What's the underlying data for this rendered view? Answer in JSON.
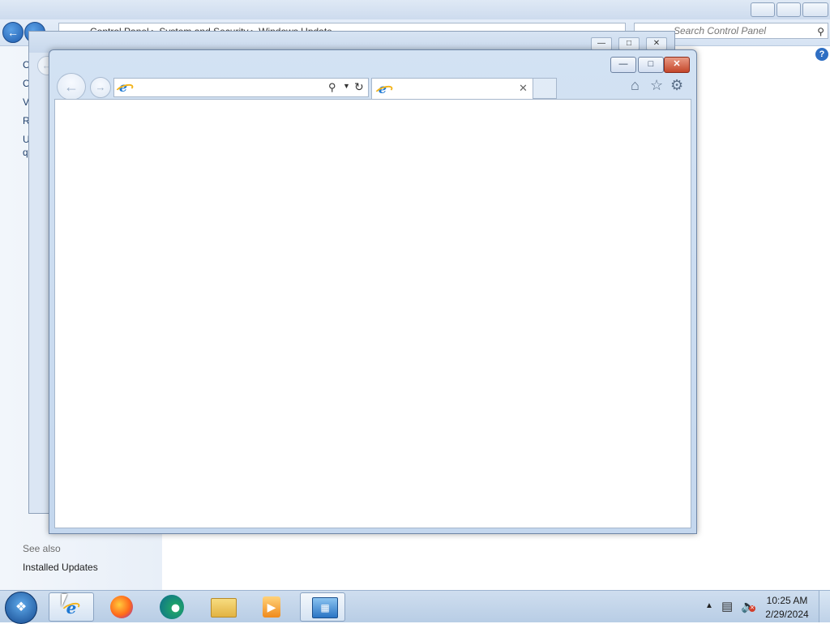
{
  "control_panel": {
    "address_text": "Control Panel ▸ System and Security ▸ Windows Update",
    "search_placeholder": "Search Control Panel",
    "sidebar_letters": [
      "C",
      "C",
      "V",
      "R",
      "U",
      "q"
    ],
    "see_also": "See also",
    "installed_updates": "Installed Updates"
  },
  "ie": {
    "address_value": "",
    "tab_title": "",
    "icons": {
      "back": "back-arrow-icon",
      "forward": "forward-arrow-icon",
      "search": "search-icon",
      "refresh": "refresh-icon",
      "close_tab": "close-icon",
      "home": "home-icon",
      "favorites": "star-icon",
      "tools": "gear-icon"
    }
  },
  "taskbar": {
    "items": [
      "Internet Explorer",
      "Firefox",
      "Edge",
      "Windows Explorer",
      "Media Player",
      "Control Panel"
    ],
    "time": "10:25 AM",
    "date": "2/29/2024"
  },
  "colors": {
    "window_frame": "#c4d7ee",
    "close_button": "#c4472b",
    "taskbar": "#b8cde5"
  }
}
